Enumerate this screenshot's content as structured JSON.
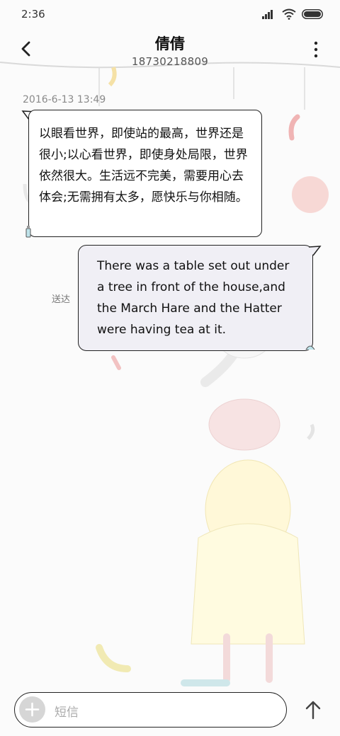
{
  "status_bar": {
    "time": "2:36"
  },
  "header": {
    "contact_name": "倩倩",
    "contact_number": "18730218809"
  },
  "conversation": {
    "timestamp": "2016-6-13 13:49",
    "incoming_message": "以眼看世界，即使站的最高，世界还是很小;以心看世界，即使身处局限，世界依然很大。生活远不完美，需要用心去体会;无需拥有太多，愿快乐与你相随。",
    "outgoing_message": "There was a table set out under a tree in front of the house,and the March Hare and the Hatter were having tea at it.",
    "outgoing_status": "送达"
  },
  "compose": {
    "placeholder": "短信"
  },
  "colors": {
    "incoming_bubble": "#ffffff",
    "outgoing_bubble": "#f0eff5",
    "bubble_border": "#222222"
  }
}
